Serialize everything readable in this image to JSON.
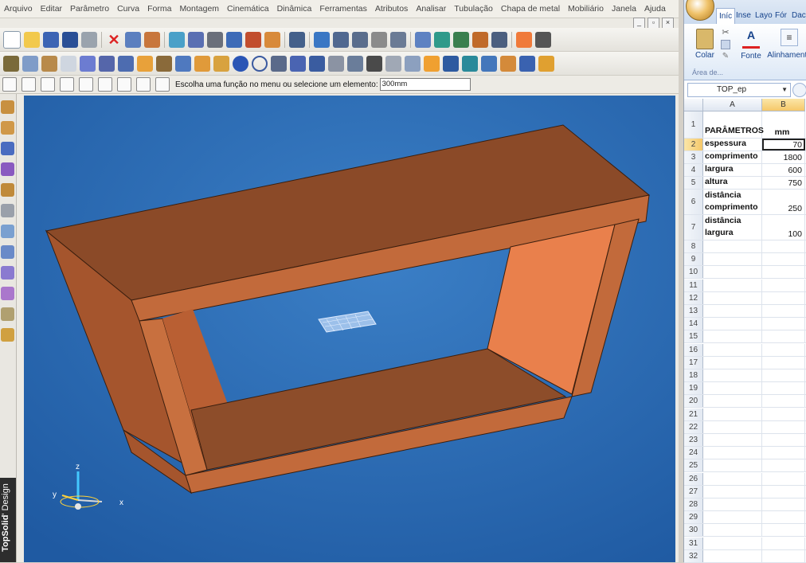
{
  "cad": {
    "menu": [
      "Arquivo",
      "Editar",
      "Parâmetro",
      "Curva",
      "Forma",
      "Montagem",
      "Cinemática",
      "Dinâmica",
      "Ferramentas",
      "Atributos",
      "Analisar",
      "Tubulação",
      "Chapa de metal",
      "Mobiliário",
      "Janela",
      "Ajuda"
    ],
    "window_controls": [
      "_",
      "▫",
      "×"
    ],
    "command_prompt": "Escolha uma função no menu ou selecione um elemento:",
    "command_value": "300mm",
    "brand_bold": "TopSolid",
    "brand_light": "' Design",
    "axis_labels": {
      "x": "x",
      "y": "y",
      "z": "z"
    },
    "colors": {
      "viewport_bg": "#2e6fb5",
      "model_top": "#8b4a28",
      "model_side": "#c0683c",
      "model_inner": "#e9804c"
    }
  },
  "excel": {
    "ribbon_tabs": [
      "Iníc",
      "Inse",
      "Layo",
      "Fór",
      "Dac"
    ],
    "groups": {
      "paste": "Colar",
      "font": "Fonte",
      "align": "Alinhamento",
      "clipboard": "Área de..."
    },
    "name_box": "TOP_ep",
    "columns": [
      "A",
      "B"
    ],
    "rows": [
      {
        "n": "1",
        "a": "PARÂMETROS",
        "b": "mm"
      },
      {
        "n": "2",
        "a": "espessura",
        "b": "70"
      },
      {
        "n": "3",
        "a": "comprimento",
        "b": "1800"
      },
      {
        "n": "4",
        "a": "largura",
        "b": "600"
      },
      {
        "n": "5",
        "a": "altura",
        "b": "750"
      },
      {
        "n": "6",
        "a": "distância comprimento",
        "b": "250"
      },
      {
        "n": "7",
        "a": "distância largura",
        "b": "100"
      }
    ],
    "empty_rows": [
      "8",
      "9",
      "10",
      "11",
      "12",
      "13",
      "14",
      "15",
      "16",
      "17",
      "18",
      "19",
      "20",
      "21",
      "22",
      "23",
      "24",
      "25",
      "26",
      "27",
      "28",
      "29",
      "30",
      "31",
      "32"
    ]
  }
}
